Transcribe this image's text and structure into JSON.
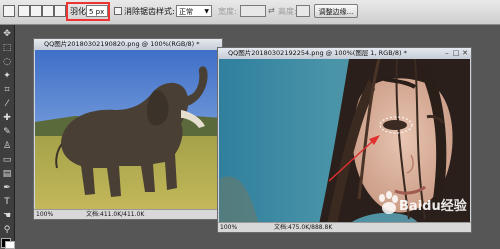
{
  "options_bar": {
    "feather_label": "羽化:",
    "feather_value": "5 px",
    "antialias_label": "消除锯齿",
    "style_label": "样式:",
    "style_value": "正常",
    "width_label": "宽度:",
    "height_label": "高度:",
    "refine_edge_button": "调整边缘..."
  },
  "documents": [
    {
      "title": "QQ图片20180302190820.png @ 100%(RGB/8) *",
      "zoom": "100%",
      "doc_info": "文档:411.0K/411.0K"
    },
    {
      "title": "QQ图片20180302192254.png @ 100%(图层 1, RGB/8) *",
      "zoom": "100%",
      "doc_info": "文档:475.0K/888.8K"
    }
  ],
  "colors": {
    "highlight": "#e33333",
    "arrow": "#e03030"
  },
  "watermark": "Baidu经验"
}
